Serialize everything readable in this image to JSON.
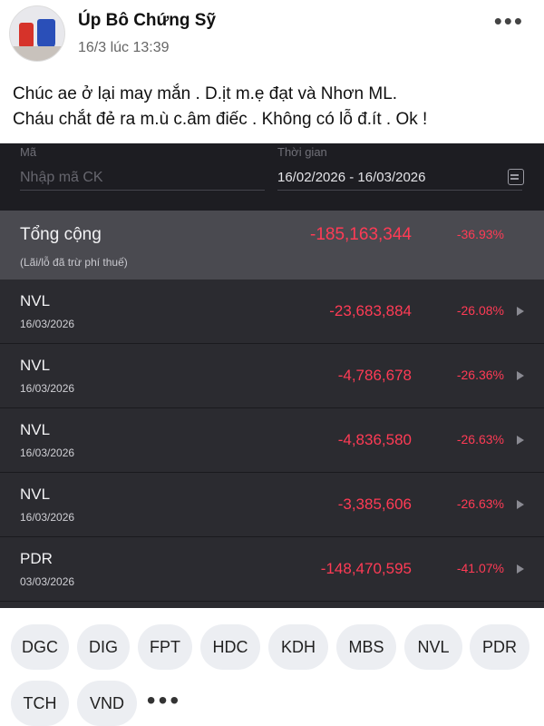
{
  "post": {
    "author": "Úp Bô Chứng Sỹ",
    "timestamp": "16/3 lúc 13:39",
    "more_icon": "•••",
    "text_lines": [
      "Chúc ae ở lại may mắn . D.ịt m.ẹ đạt và Nhơn ML.",
      "Cháu chắt đẻ ra m.ù c.âm điếc . Không có lỗ đ.ít . Ok !"
    ]
  },
  "filters": {
    "code_label": "Mã",
    "code_placeholder": "Nhập mã CK",
    "time_label": "Thời gian",
    "date_range": "16/02/2026 - 16/03/2026"
  },
  "total": {
    "name": "Tổng cộng",
    "note": "(Lãi/lỗ đã trừ phí thuế)",
    "value": "-185,163,344",
    "percent": "-36.93%"
  },
  "rows": [
    {
      "code": "NVL",
      "date": "16/03/2026",
      "value": "-23,683,884",
      "percent": "-26.08%"
    },
    {
      "code": "NVL",
      "date": "16/03/2026",
      "value": "-4,786,678",
      "percent": "-26.36%"
    },
    {
      "code": "NVL",
      "date": "16/03/2026",
      "value": "-4,836,580",
      "percent": "-26.63%"
    },
    {
      "code": "NVL",
      "date": "16/03/2026",
      "value": "-3,385,606",
      "percent": "-26.63%"
    },
    {
      "code": "PDR",
      "date": "03/03/2026",
      "value": "-148,470,595",
      "percent": "-41.07%"
    }
  ],
  "tags": [
    "DGC",
    "DIG",
    "FPT",
    "HDC",
    "KDH",
    "MBS",
    "NVL",
    "PDR",
    "TCH",
    "VND"
  ],
  "tags_more": "•••",
  "colors": {
    "loss": "#ff3b55",
    "panel": "#2b2b30",
    "total_row": "#4a4a50"
  }
}
